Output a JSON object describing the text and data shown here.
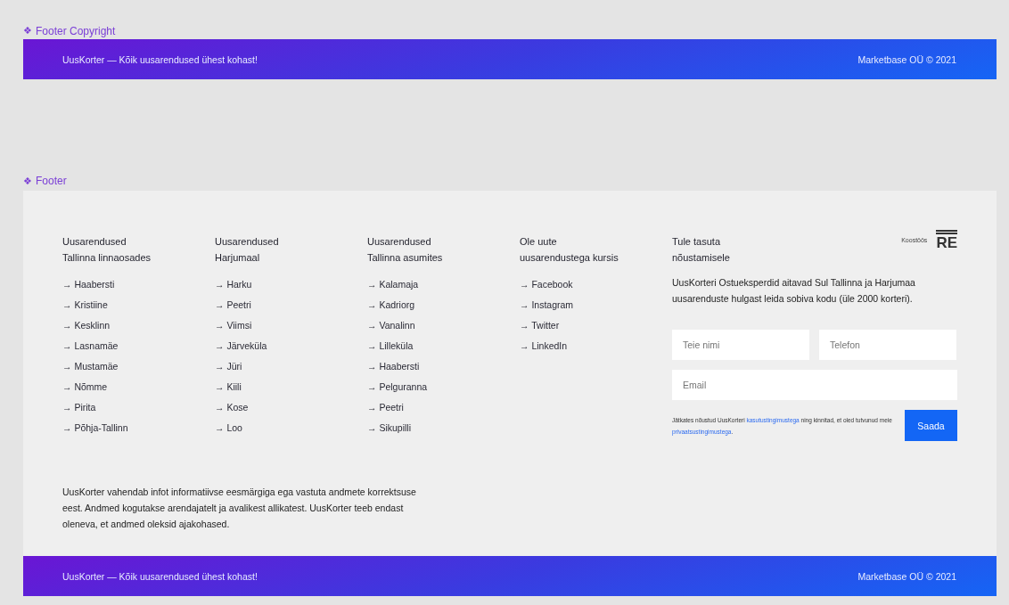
{
  "frames": [
    {
      "icon": "❖",
      "label": "Footer Copyright"
    },
    {
      "icon": "❖",
      "label": "Footer"
    }
  ],
  "copyright_bar": {
    "tagline": "UusKorter — Kõik uusarendused ühest kohast!",
    "copyright": "Marketbase OÜ © 2021"
  },
  "columns": [
    {
      "heading": [
        "Uusarendused",
        "Tallinna linnaosades"
      ],
      "links": [
        "→ Haabersti",
        "→ Kristiine",
        "→ Kesklinn",
        "→ Lasnamäe",
        "→ Mustamäe",
        "→ Nõmme",
        "→ Pirita",
        "→ Põhja-Tallinn"
      ]
    },
    {
      "heading": [
        "Uusarendused",
        "Harjumaal"
      ],
      "links": [
        "→ Harku",
        "→ Peetri",
        "→ Viimsi",
        "→ Järveküla",
        "→ Jüri",
        "→ Kiili",
        "→ Kose",
        "→ Loo"
      ]
    },
    {
      "heading": [
        "Uusarendused",
        "Tallinna asumites"
      ],
      "links": [
        "→ Kalamaja",
        "→ Kadriorg",
        "→ Vanalinn",
        "→ Lilleküla",
        "→ Haabersti",
        "→ Pelguranna",
        "→ Peetri",
        "→ Sikupilli"
      ]
    },
    {
      "heading": [
        "Ole uute",
        "uusarendustega kursis"
      ],
      "links": [
        "→ Facebook",
        "→ Instagram",
        "→ Twitter",
        "→ LinkedIn"
      ]
    }
  ],
  "contact": {
    "heading": [
      "Tule tasuta",
      "nõustamisele"
    ],
    "partner_label": "Koostöös",
    "partner_logo": "RE",
    "description": "UusKorteri Ostueksperdid aitavad Sul Tallinna ja Harjumaa uusarenduste hulgast leida sobiva kodu (üle 2000 korteri).",
    "name_placeholder": "Teie nimi",
    "phone_placeholder": "Telefon",
    "email_placeholder": "Email",
    "consent": [
      "Jätkates nõustud UusKorteri ",
      "kasutustingimustega",
      " ning kinnitad, et oled tutvunud meie ",
      "privaatsustingimustega",
      "."
    ],
    "submit": "Saada"
  },
  "disclaimer": "UusKorter vahendab infot informatiivse eesmärgiga ega vastuta andmete korrektsuse eest. Andmed kogutakse arendajatelt ja avalikest allikatest. UusKorter teeb endast oleneva, et andmed oleksid ajakohased.",
  "footer_bar": {
    "tagline": "UusKorter — Kõik uusarendused ühest kohast!",
    "copyright": "Marketbase OÜ © 2021"
  }
}
